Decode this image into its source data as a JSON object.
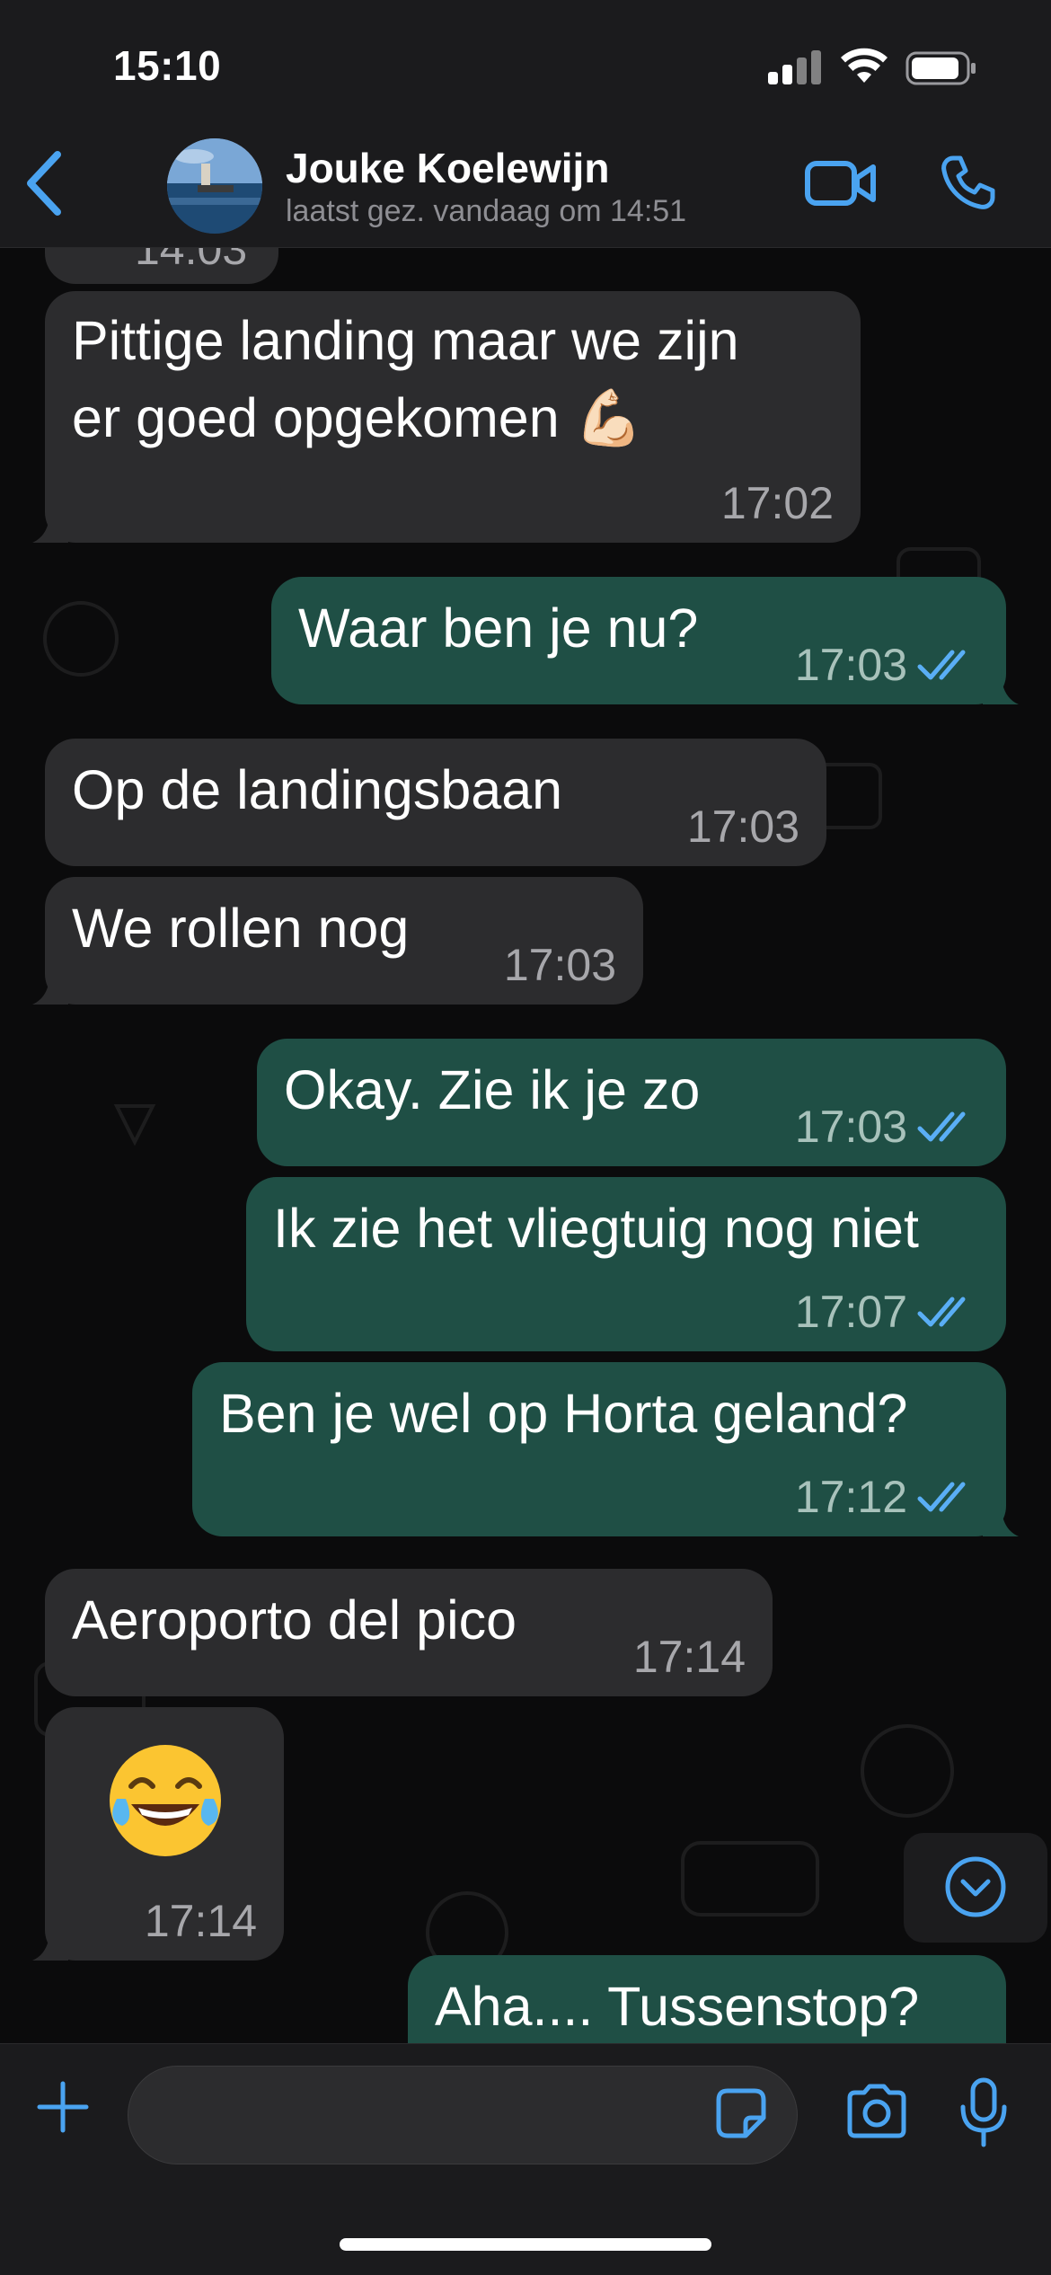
{
  "status_bar": {
    "time": "15:10"
  },
  "header": {
    "back_icon": "chevron-left-icon",
    "contact_name": "Jouke Koelewijn",
    "last_seen": "laatst gez. vandaag om 14:51",
    "video_icon": "video-camera-icon",
    "call_icon": "phone-icon"
  },
  "messages": [
    {
      "direction": "in",
      "text": "14:03",
      "time": ""
    },
    {
      "direction": "in",
      "text_line1": "Pittige landing maar we zijn",
      "text_line2": "er goed opgekomen 💪🏻",
      "time": "17:02"
    },
    {
      "direction": "out",
      "text": "Waar ben je nu?",
      "time": "17:03",
      "status": "read"
    },
    {
      "direction": "in",
      "text": "Op de landingsbaan",
      "time": "17:03"
    },
    {
      "direction": "in",
      "text": "We rollen nog",
      "time": "17:03"
    },
    {
      "direction": "out",
      "text": "Okay. Zie ik je zo",
      "time": "17:03",
      "status": "read"
    },
    {
      "direction": "out",
      "text": "Ik zie het vliegtuig nog niet",
      "time": "17:07",
      "status": "read"
    },
    {
      "direction": "out",
      "text": "Ben je wel op Horta geland?",
      "time": "17:12",
      "status": "read"
    },
    {
      "direction": "in",
      "text": "Aeroporto del pico",
      "time": "17:14"
    },
    {
      "direction": "in",
      "text": "😂",
      "time": "17:14"
    },
    {
      "direction": "out",
      "text": "Aha.... Tussenstop?",
      "time": ""
    }
  ],
  "input": {
    "value": "",
    "placeholder": ""
  },
  "colors": {
    "accent": "#4aa3f0",
    "incoming_bubble": "#2c2c2e",
    "outgoing_bubble": "#1f4f45",
    "read_ticks": "#5aaef5"
  }
}
